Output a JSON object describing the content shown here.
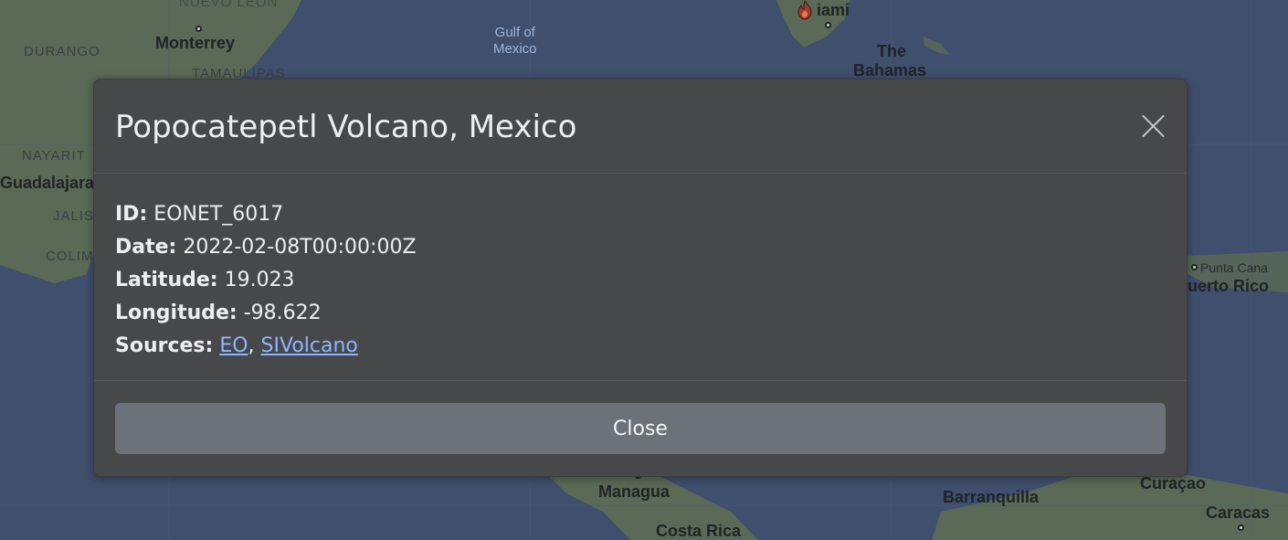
{
  "map": {
    "water_labels": [
      {
        "text": "Gulf of",
        "text2": "Mexico"
      }
    ],
    "city_labels": [
      "Monterrey",
      "Guadalajara",
      "Managua",
      "Costa Rica",
      "Barranquilla",
      "Caracas",
      "Curaçao",
      "uerto Rico",
      "Punta Cana",
      "iami"
    ],
    "region_labels": [
      "DURANGO",
      "TAMAULIPAS",
      "NAYARIT",
      "JALIS",
      "COLIM",
      "NUEVO LEÓN"
    ],
    "bahamas": {
      "line1": "The",
      "line2": "Bahamas"
    },
    "marker_icon": "fire-icon"
  },
  "modal": {
    "title": "Popocatepetl Volcano, Mexico",
    "close_icon": "close-icon",
    "fields": {
      "id_label": "ID:",
      "id_value": "EONET_6017",
      "date_label": "Date:",
      "date_value": "2022-02-08T00:00:00Z",
      "lat_label": "Latitude:",
      "lat_value": "19.023",
      "lon_label": "Longitude:",
      "lon_value": "-98.622",
      "sources_label": "Sources:",
      "source_1": "EO",
      "separator": ",",
      "source_2": "SIVolcano"
    },
    "close_button_label": "Close"
  },
  "colors": {
    "water": "#3f4f6d",
    "land": "#5d6b58",
    "modal_bg": "#474849",
    "link": "#8db4ff",
    "button": "#6c7278"
  }
}
